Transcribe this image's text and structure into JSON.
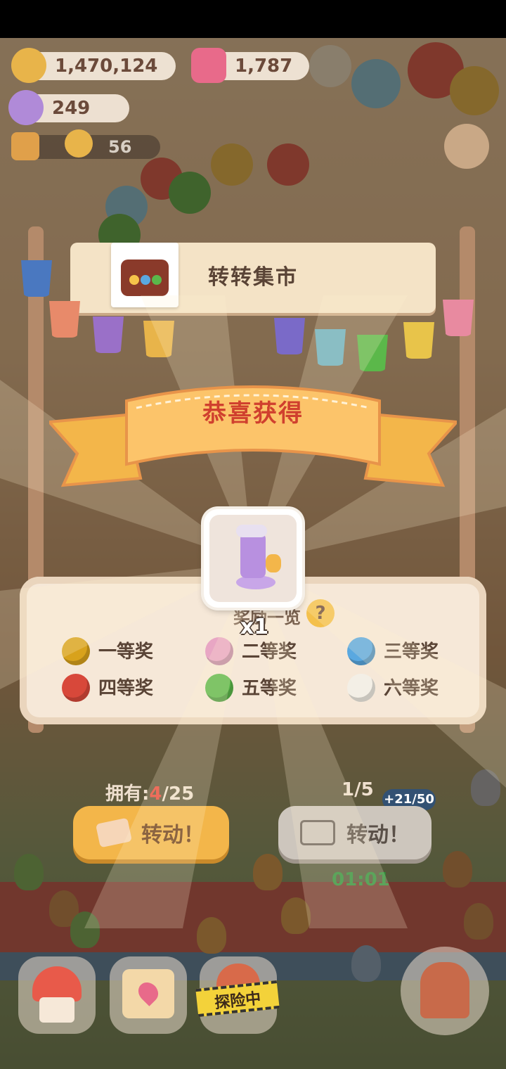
{
  "currencies": {
    "cookies": "1,470,124",
    "gems": "1,787",
    "candy": "249",
    "announcement_count": "56"
  },
  "stall": {
    "title": "转转集市",
    "reward_list_title": "奖励一览",
    "help_symbol": "?",
    "prizes": [
      {
        "label": "一等奖",
        "color": "#d8a21c"
      },
      {
        "label": "二等奖",
        "color": "#e8a6c4"
      },
      {
        "label": "三等奖",
        "color": "#5aa8e0"
      },
      {
        "label": "四等奖",
        "color": "#d8483a"
      },
      {
        "label": "五等奖",
        "color": "#5bb84a"
      },
      {
        "label": "六等奖",
        "color": "#f3efe6"
      }
    ]
  },
  "popup": {
    "title": "恭喜获得",
    "quantity": "x1",
    "item_icon": "cat-tower-icon"
  },
  "spin": {
    "owned_label": "拥有:",
    "owned_current": "4",
    "owned_total": "/25",
    "ratio": "1/5",
    "ticket_button": "转动！",
    "video_button": "转动！",
    "timer": "01:01",
    "side_badge": "+21/50"
  },
  "nav": {
    "explore_label": "探险中"
  },
  "colors": {
    "accent_orange": "#f3b64a",
    "title_red": "#d0402e",
    "timer_green": "#2f8f3a"
  }
}
